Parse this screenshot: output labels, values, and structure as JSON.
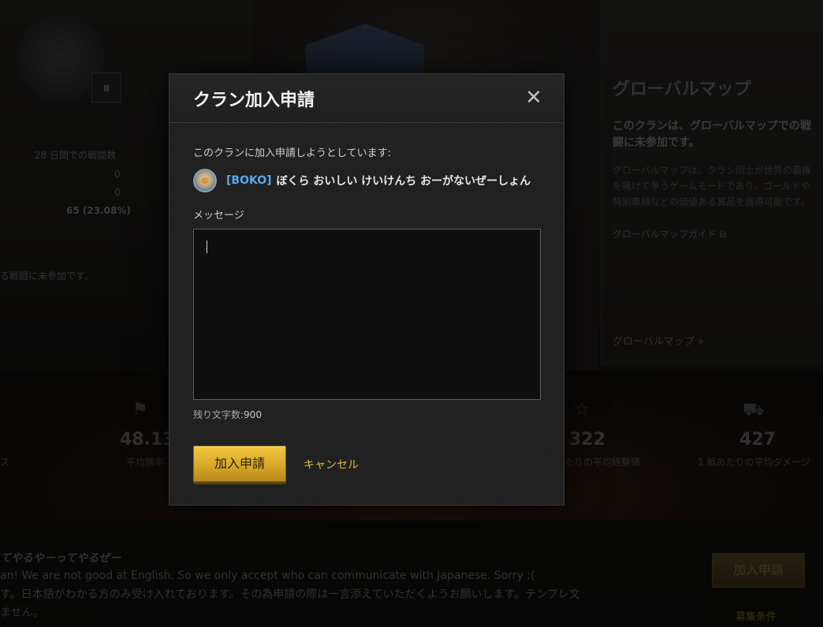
{
  "background": {
    "pause_icon": "pause-icon",
    "stats_label": "28 日間での戦闘数",
    "stat_values": [
      "0",
      "0"
    ],
    "stat_pct": "65 (23.08%)",
    "left_note": "る戦闘に未参加です。",
    "global_map": {
      "title": "グローバルマップ",
      "bold_text": "このクランは、グローバルマップでの戦闘に未参加です。",
      "description": "グローバルマップは、クラン同士が世界の覇権を賭けて争うゲームモードであり、ゴールドや特別車輌などの価値ある賞品を獲得可能です。",
      "guide_link": "グローバルマップガイド ⧉",
      "map_link": "グローバルマップ »"
    },
    "stats": [
      {
        "icon": "flag-icon",
        "value": "48.13%",
        "label": "平均勝率"
      },
      {
        "icon": "star-icon",
        "value": "322",
        "label": "たりの平均経験値"
      },
      {
        "icon": "tank-icon",
        "value": "427",
        "label": "1 戦あたりの平均ダメージ"
      }
    ],
    "stat_left_fragment": "ス",
    "footer": {
      "title": "てやるやーってやるぜー",
      "line1": "an! We are not good at English. So we only accept who can communicate with Japanese. Sorry :(",
      "line2": "す。日本語がわかる方のみ受け入れております。その為申請の際は一言添えていただくようお願いします。テンプレ文",
      "line3": "ません。",
      "join_button": "加入申請",
      "criteria_link": "募集条件"
    }
  },
  "modal": {
    "title": "クラン加入申請",
    "close_icon": "close-icon",
    "intro": "このクランに加入申請しようとしています:",
    "clan_tag": "[BOKO]",
    "clan_name": "ぼくら おいしい けいけんち おーがないぜーしょん",
    "message_label": "メッセージ",
    "message_value": "",
    "remaining_label": "残り文字数:",
    "remaining_count": "900",
    "submit_label": "加入申請",
    "cancel_label": "キャンセル"
  },
  "colors": {
    "accent_gold": "#e8b437",
    "clan_tag_blue": "#5aa8e6",
    "modal_bg": "#202020"
  }
}
